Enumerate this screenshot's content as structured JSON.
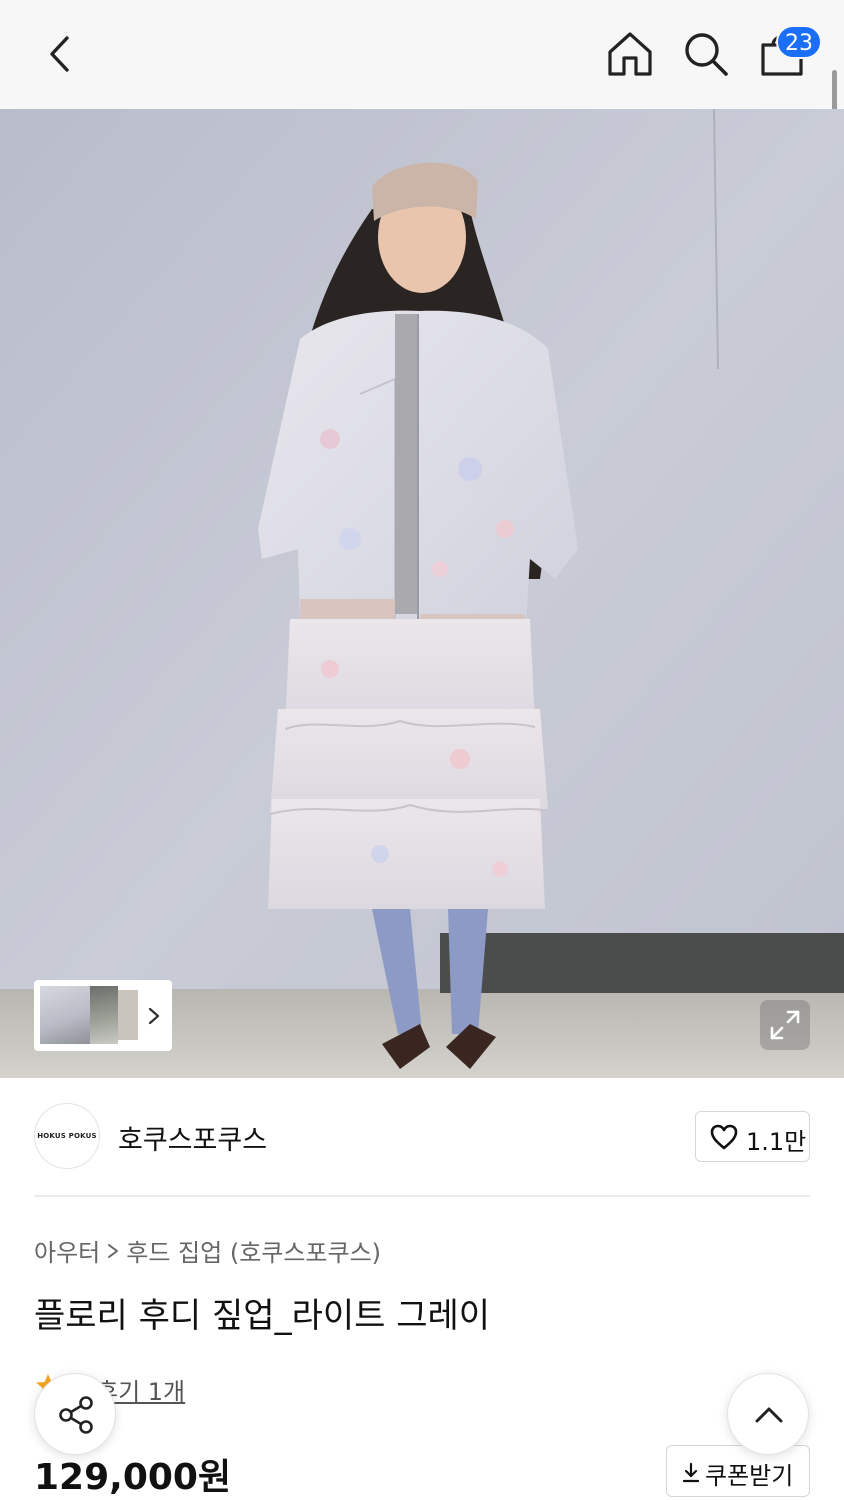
{
  "header": {
    "icons": [
      "back-arrow-icon",
      "home-icon",
      "search-icon",
      "shopping-bag-icon"
    ],
    "cart_count": "23"
  },
  "gallery": {
    "expand_icon": "expand-icon",
    "thumb_arrow_icon": "chevron-right-icon"
  },
  "brand": {
    "logo_text": "HOKUS POKUS",
    "name": "호쿠스포쿠스",
    "like_count": "1.1만",
    "like_icon": "heart-icon"
  },
  "product": {
    "breadcrumb": [
      "아우터",
      "후드 집업 (호쿠스포쿠스)"
    ],
    "title": "플로리 후디 짚업_라이트 그레이",
    "review_label": "후기 1개",
    "price": "129,000원",
    "coupon_label": "쿠폰받기"
  },
  "colors": {
    "accent": "#1a6ef7",
    "star": "#f5a623"
  },
  "floating": {
    "share_icon": "share-icon",
    "top_icon": "chevron-up-icon"
  }
}
